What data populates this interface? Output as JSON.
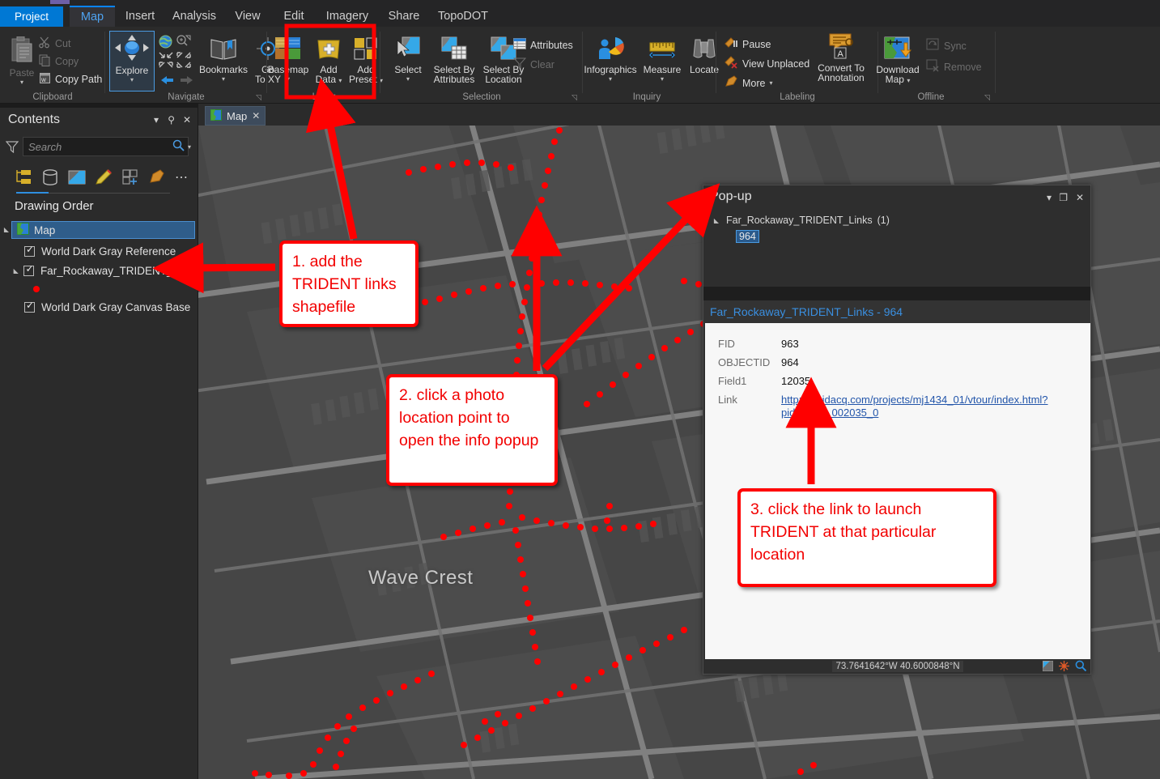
{
  "app": {
    "tabs": [
      {
        "label": "Project",
        "state": "project"
      },
      {
        "label": "Map",
        "state": "active"
      },
      {
        "label": "Insert",
        "state": "normal"
      },
      {
        "label": "Analysis",
        "state": "normal"
      },
      {
        "label": "View",
        "state": "normal"
      },
      {
        "label": "Edit",
        "state": "normal"
      },
      {
        "label": "Imagery",
        "state": "normal"
      },
      {
        "label": "Share",
        "state": "normal"
      },
      {
        "label": "TopoDOT",
        "state": "normal"
      }
    ]
  },
  "ribbon": {
    "groups": [
      {
        "name": "Clipboard",
        "title": "Clipboard"
      },
      {
        "name": "Navigate",
        "title": "Navigate"
      },
      {
        "name": "Layer",
        "title": "Layer"
      },
      {
        "name": "Selection",
        "title": "Selection"
      },
      {
        "name": "Inquiry",
        "title": "Inquiry"
      },
      {
        "name": "Labeling",
        "title": "Labeling"
      },
      {
        "name": "Offline",
        "title": "Offline"
      }
    ],
    "clipboard": {
      "paste": "Paste",
      "cut": "Cut",
      "copy": "Copy",
      "copy_path": "Copy Path"
    },
    "navigate": {
      "explore": "Explore",
      "bookmarks": "Bookmarks",
      "go_to_xy_line1": "Go",
      "go_to_xy_line2": "To XY"
    },
    "layer": {
      "basemap": "Basemap",
      "add_data_line1": "Add",
      "add_data_line2": "Data",
      "add_preset_line1": "Add",
      "add_preset_line2": "Preset"
    },
    "selection": {
      "select": "Select",
      "select_by_attributes_line1": "Select By",
      "select_by_attributes_line2": "Attributes",
      "select_by_location_line1": "Select By",
      "select_by_location_line2": "Location",
      "attributes": "Attributes",
      "clear": "Clear"
    },
    "inquiry": {
      "infographics": "Infographics",
      "measure": "Measure",
      "locate": "Locate"
    },
    "labeling": {
      "pause": "Pause",
      "view_unplaced": "View Unplaced",
      "more": "More",
      "convert_line1": "Convert To",
      "convert_line2": "Annotation"
    },
    "offline": {
      "download_line1": "Download",
      "download_line2": "Map",
      "sync": "Sync",
      "remove": "Remove"
    }
  },
  "maptabbar": {
    "tab_label": "Map"
  },
  "contents": {
    "title": "Contents",
    "search_placeholder": "Search",
    "search_value": "",
    "drawing_order": "Drawing Order",
    "layers": [
      {
        "label": "Map",
        "type": "map"
      },
      {
        "label": "World Dark Gray Reference",
        "checked": true
      },
      {
        "label": "Far_Rockaway_TRIDENT_Links",
        "checked": true
      },
      {
        "label": "World Dark Gray Canvas Base",
        "checked": true
      }
    ]
  },
  "map": {
    "place_label": "Wave Crest"
  },
  "popup": {
    "title": "Pop-up",
    "tree_root": "Far_Rockaway_TRIDENT_Links",
    "tree_root_count": "(1)",
    "tree_child": "964",
    "subtitle": "Far_Rockaway_TRIDENT_Links - 964",
    "fields": [
      {
        "name": "FID",
        "value": "963"
      },
      {
        "name": "OBJECTID",
        "value": "964"
      },
      {
        "name": "Field1",
        "value": "12035"
      }
    ],
    "link_label": "Link",
    "link_text": "http://3d.idacq.com/projects/mj1434_01/vtour/index.html?pid=LB_2_002035_0",
    "coordinates": "73.7641642°W 40.6000848°N"
  },
  "callouts": [
    {
      "id": "callout1",
      "text": "1. add the TRIDENT links shapefile"
    },
    {
      "id": "callout2",
      "text": "2. click a photo location point to open the info popup"
    },
    {
      "id": "callout3",
      "text": "3. click the link to launch TRIDENT at that particular location"
    }
  ],
  "colors": {
    "accent": "#0078d4",
    "annotation_red": "#ff0000",
    "link_blue": "#2255aa",
    "point_red": "#ff0000"
  }
}
